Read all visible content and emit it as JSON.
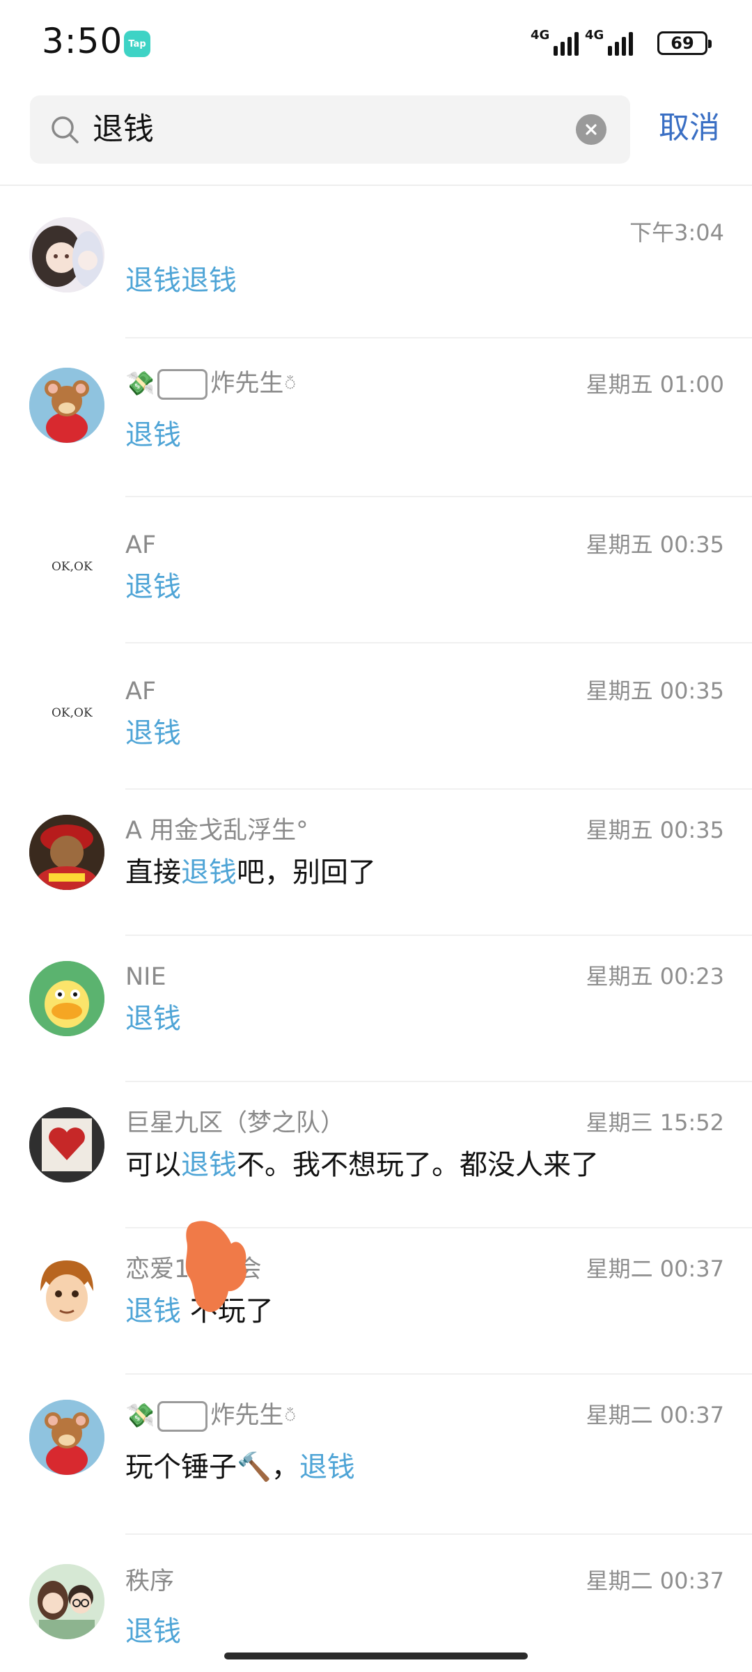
{
  "status": {
    "time": "3:50",
    "app_badge": "Tap",
    "signal_label_1": "4G",
    "signal_label_2": "4G",
    "battery": "69"
  },
  "search": {
    "query": "退钱",
    "cancel": "取消"
  },
  "results": [
    {
      "name": "",
      "time": "下午3:04",
      "pre": "",
      "hl": "退钱退钱",
      "post": "",
      "avatar": "anime-girl"
    },
    {
      "name": "炸先生",
      "time": "星期五 01:00",
      "pre": "",
      "hl": "退钱",
      "post": "",
      "avatar": "jerry"
    },
    {
      "name": "AF",
      "time": "星期五 00:35",
      "pre": "",
      "hl": "退钱",
      "post": "",
      "avatar": "okok"
    },
    {
      "name": "AF",
      "time": "星期五 00:35",
      "pre": "",
      "hl": "退钱",
      "post": "",
      "avatar": "okok"
    },
    {
      "name": "A    用金戈乱浮生°",
      "time": "星期五 00:35",
      "pre": "直接",
      "hl": "退钱",
      "post": "吧，别回了",
      "avatar": "wukong"
    },
    {
      "name": "NIE",
      "time": "星期五 00:23",
      "pre": "",
      "hl": "退钱",
      "post": "",
      "avatar": "duck"
    },
    {
      "name": "巨星九区（梦之队）",
      "time": "星期三 15:52",
      "pre": "可以",
      "hl": "退钱",
      "post": "不。我不想玩了。都没人来了",
      "avatar": "heart"
    },
    {
      "name": "恋爱1%机会",
      "time": "星期二 00:37",
      "pre": "",
      "hl": "退钱",
      "post": "  不玩了",
      "avatar": "boy"
    },
    {
      "name": "炸先生",
      "time": "星期二 00:37",
      "pre": "玩个锤子🔨，",
      "hl": "退钱",
      "post": "",
      "avatar": "jerry"
    },
    {
      "name": "秩序",
      "time": "星期二 00:37",
      "pre": "",
      "hl": "退钱",
      "post": "",
      "avatar": "couple"
    }
  ],
  "colors": {
    "highlight": "#4ea4d6",
    "cancel": "#3a6fc4",
    "secondary_text": "#8a8a8a"
  }
}
